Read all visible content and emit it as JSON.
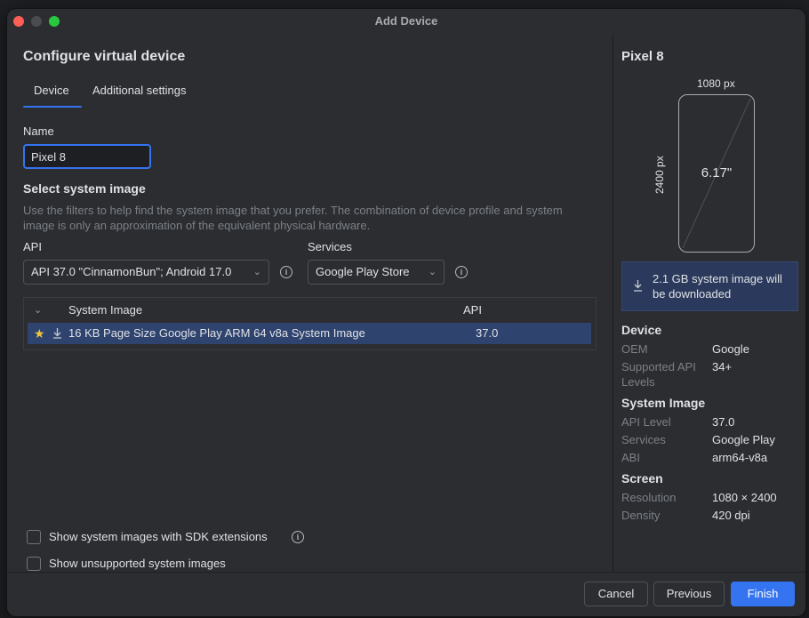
{
  "window": {
    "title": "Add Device"
  },
  "left": {
    "heading": "Configure virtual device",
    "tabs": [
      {
        "label": "Device",
        "selected": true
      },
      {
        "label": "Additional settings",
        "selected": false
      }
    ],
    "name_label": "Name",
    "name_value": "Pixel 8",
    "section_title": "Select system image",
    "description": "Use the filters to help find the system image that you prefer. The combination of device profile and system image is only an approximation of the equivalent physical hardware.",
    "api_label": "API",
    "api_value": "API 37.0 \"CinnamonBun\"; Android 17.0",
    "services_label": "Services",
    "services_value": "Google Play Store",
    "table": {
      "columns": [
        "System Image",
        "API"
      ],
      "rows": [
        {
          "name": "16 KB Page Size Google Play ARM 64 v8a System Image",
          "api": "37.0",
          "starred": true,
          "selected": true
        }
      ]
    },
    "checkboxes": [
      {
        "label": "Show system images with SDK extensions",
        "checked": false
      },
      {
        "label": "Show unsupported system images",
        "checked": false
      }
    ]
  },
  "right": {
    "device_name": "Pixel 8",
    "width_px": "1080 px",
    "height_px": "2400 px",
    "diagonal": "6.17\"",
    "notice": "2.1 GB system image will be downloaded",
    "device_section": "Device",
    "oem_label": "OEM",
    "oem_value": "Google",
    "api_levels_label": "Supported API Levels",
    "api_levels_value": "34+",
    "system_image_section": "System Image",
    "api_level_label": "API Level",
    "api_level_value": "37.0",
    "services_label": "Services",
    "services_value": "Google Play",
    "abi_label": "ABI",
    "abi_value": "arm64-v8a",
    "screen_section": "Screen",
    "resolution_label": "Resolution",
    "resolution_value": "1080 × 2400",
    "density_label": "Density",
    "density_value": "420 dpi"
  },
  "footer": {
    "cancel": "Cancel",
    "previous": "Previous",
    "finish": "Finish"
  },
  "icons": {
    "dropdown": "chevron-down-icon",
    "info": "info-icon",
    "star": "star-icon",
    "download": "download-icon"
  },
  "colors": {
    "accent": "#3574f0",
    "selection": "#2e436e",
    "star": "#f0c53b",
    "background": "#2b2d30"
  }
}
